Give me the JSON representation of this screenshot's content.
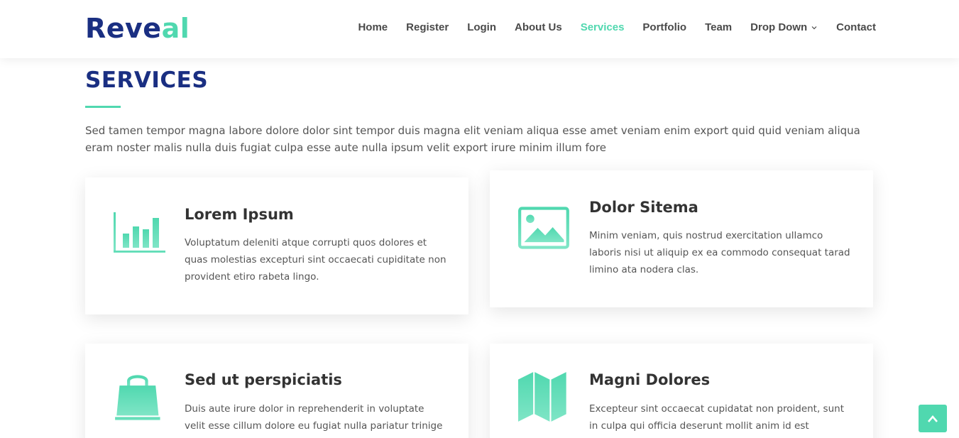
{
  "brand": {
    "logo_part1": "Reve",
    "logo_part2": "al"
  },
  "nav": {
    "items": [
      {
        "label": "Home"
      },
      {
        "label": "Register"
      },
      {
        "label": "Login"
      },
      {
        "label": "About Us"
      },
      {
        "label": "Services",
        "active": true
      },
      {
        "label": "Portfolio"
      },
      {
        "label": "Team"
      },
      {
        "label": "Drop Down",
        "dropdown": true
      },
      {
        "label": "Contact"
      }
    ]
  },
  "services": {
    "title": "SERVICES",
    "description": "Sed tamen tempor magna labore dolore dolor sint tempor duis magna elit veniam aliqua esse amet veniam enim export quid quid veniam aliqua eram noster malis nulla duis fugiat culpa esse aute nulla ipsum velit export irure minim illum fore",
    "cards": [
      {
        "icon": "bar-chart-icon",
        "title": "Lorem Ipsum",
        "text": "Voluptatum deleniti atque corrupti quos dolores et quas molestias excepturi sint occaecati cupiditate non provident etiro rabeta lingo."
      },
      {
        "icon": "image-icon",
        "title": "Dolor Sitema",
        "text": "Minim veniam, quis nostrud exercitation ullamco laboris nisi ut aliquip ex ea commodo consequat tarad limino ata nodera clas."
      },
      {
        "icon": "shopping-bag-icon",
        "title": "Sed ut perspiciatis",
        "text": "Duis aute irure dolor in reprehenderit in voluptate velit esse cillum dolore eu fugiat nulla pariatur trinige"
      },
      {
        "icon": "map-icon",
        "title": "Magni Dolores",
        "text": "Excepteur sint occaecat cupidatat non proident, sunt in culpa qui officia deserunt mollit anim id est laborum"
      }
    ]
  },
  "colors": {
    "brand_dark": "#1a2f82",
    "accent": "#50d8af",
    "text": "#555555"
  },
  "back_to_top": {
    "icon": "chevron-up-icon"
  }
}
